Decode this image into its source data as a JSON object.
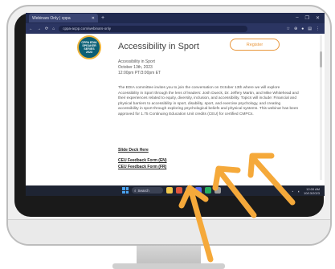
{
  "browser": {
    "tab_title": "Webinars Only | cppa",
    "new_tab_symbol": "+",
    "window_controls": [
      "‒",
      "❐",
      "✕"
    ],
    "url": "cppa-acpp.com/webinars-only",
    "nav": [
      "←",
      "→",
      "⟳",
      "⌂"
    ],
    "right_icons": [
      "☆",
      "⊕",
      "●",
      "▤",
      "⋮"
    ]
  },
  "page": {
    "logo_text": [
      "CPPA EDIA",
      "SPEAKER SERIES",
      "2023"
    ],
    "title": "Accessibility in Sport",
    "register_label": "Register",
    "meta": [
      "Accessibility in Sport",
      "October 13th, 2023",
      "12:00pm PT/3:00pm ET"
    ],
    "description": "The EDIA committee invites you to join the conversation on October 13th where we will explore Accessibility in Sport through the lens of leaders: Josh Dueck, Dr. Jeffery Martin, and Mike Whitehead and their experiences related to equity, diversity, inclusion, and accessibility. Topics will include: Financial and physical barriers to accessibility in sport, disability, sport, and exercise psychology, and creating accessibility in sport through exploring psychological beliefs and physical systems. This webinar has been approved for 1.75 Continuing Education Unit credits (CEU) for certified CMPCs.",
    "links": [
      "Slide Deck Here",
      "CEU Feedback Form (EN)",
      "CEU Feedback Form (FR)"
    ]
  },
  "taskbar": {
    "search_label": "Search",
    "clock_time": "12:00 AM",
    "clock_date": "10/13/2023"
  },
  "colors": {
    "accent": "#e9963b",
    "browser_chrome": "#202a4f",
    "arrow": "#f5a93a"
  }
}
